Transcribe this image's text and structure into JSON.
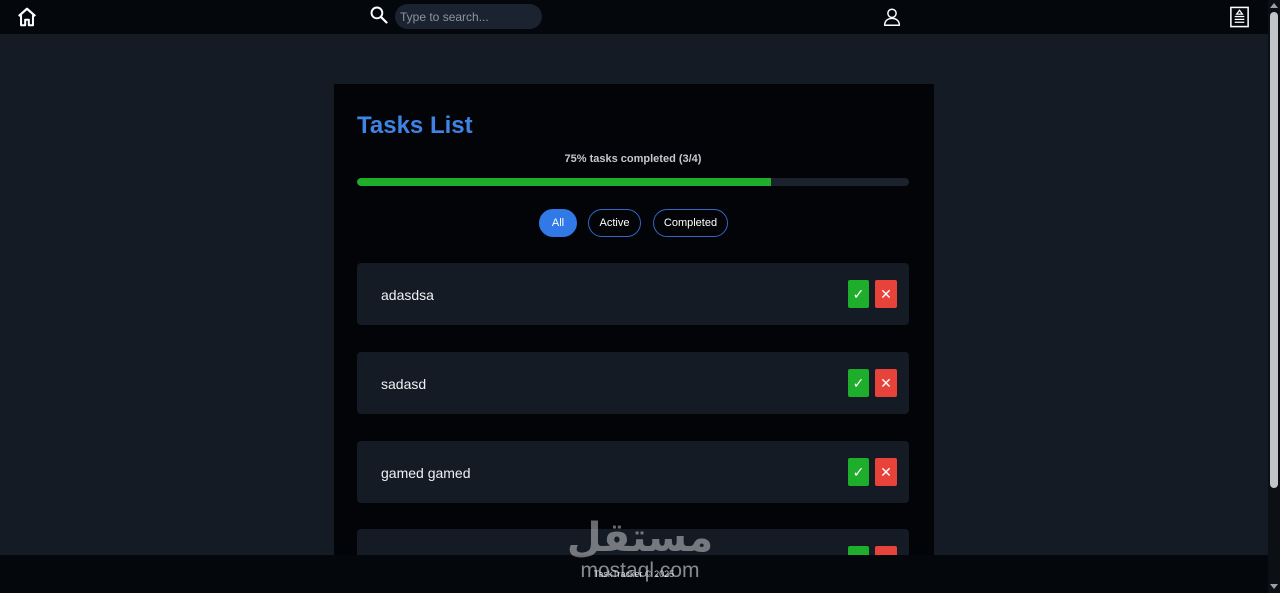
{
  "header": {
    "search_placeholder": "Type to search...",
    "icons": [
      "home-icon",
      "search-icon",
      "user-icon",
      "document-icon"
    ]
  },
  "main": {
    "title": "Tasks List",
    "progress_text": "75% tasks completed (3/4)",
    "progress_fraction": 0.75,
    "filters": [
      {
        "label": "All",
        "selected": true
      },
      {
        "label": "Active",
        "selected": false
      },
      {
        "label": "Completed",
        "selected": false
      }
    ],
    "tasks": [
      {
        "text": "adasdsa"
      },
      {
        "text": "sadasd"
      },
      {
        "text": "gamed gamed"
      },
      {
        "text": ""
      }
    ],
    "done_glyph": "✓",
    "delete_glyph": "✕"
  },
  "footer": {
    "text": "TaskTracker © 2025"
  },
  "watermark": {
    "arabic": "مستقل",
    "latin": "mostaql.com"
  },
  "colors": {
    "accent": "#3f84e5",
    "success": "#1fad2c",
    "danger": "#e8433a",
    "background": "#151b24",
    "panel": "#020407"
  }
}
